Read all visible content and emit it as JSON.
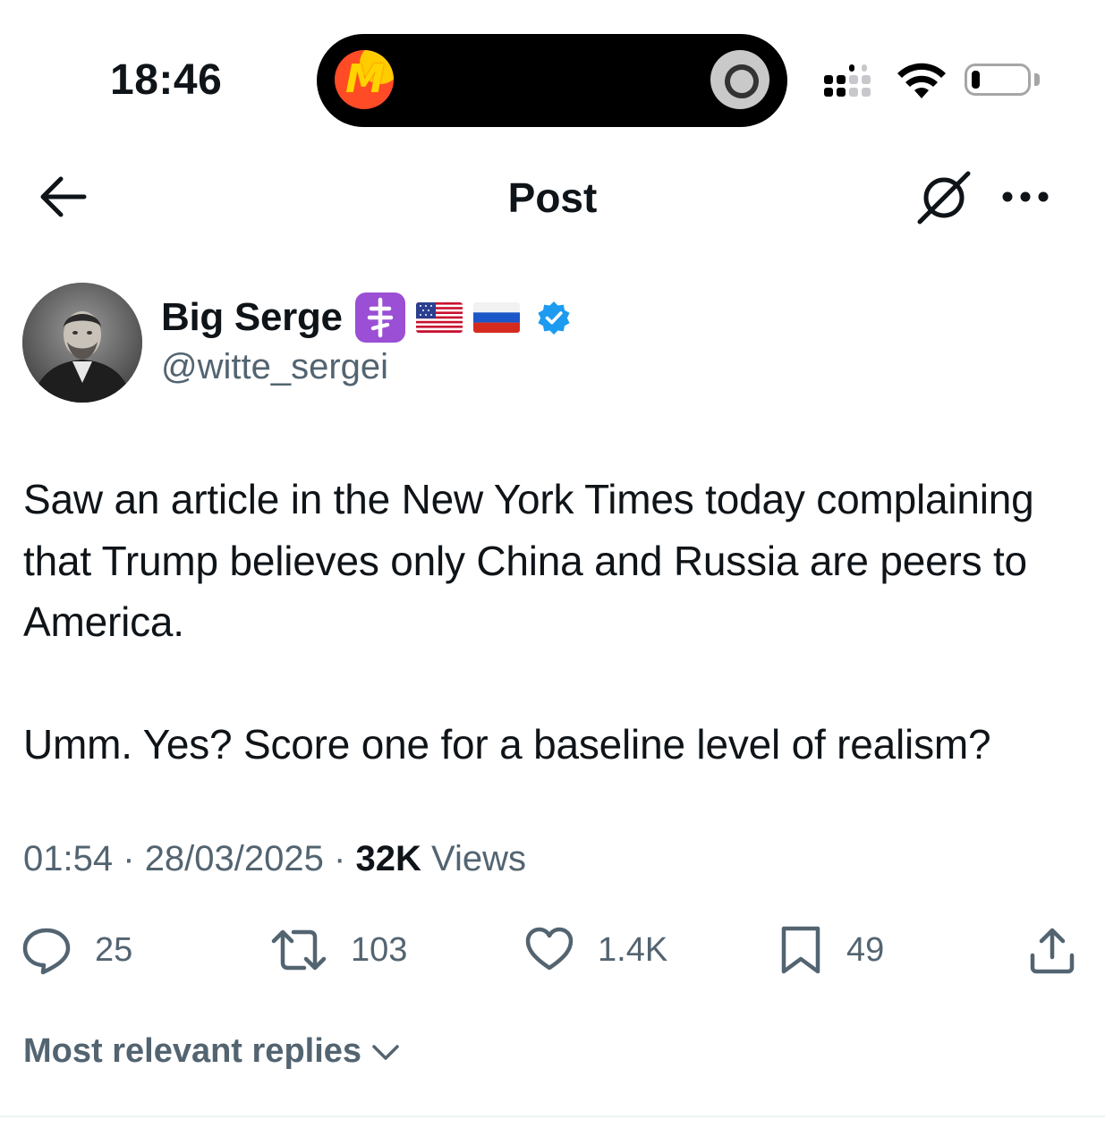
{
  "status_bar": {
    "time": "18:46",
    "battery_level": 0.15
  },
  "header": {
    "title": "Post"
  },
  "author": {
    "display_name": "Big Serge",
    "handle": "@witte_sergei",
    "badges": [
      "orthodox-cross-emoji",
      "us-flag-emoji",
      "russia-flag-emoji"
    ],
    "verified": true
  },
  "post": {
    "text": "Saw an article in the New York Times today complaining that Trump believes only China and Russia are peers to America.\n\nUmm. Yes? Score one for a baseline level of realism?",
    "time": "01:54",
    "separator": "·",
    "date": "28/03/2025",
    "views_count": "32K",
    "views_label": "Views"
  },
  "actions": {
    "replies": "25",
    "reposts": "103",
    "likes": "1.4K",
    "bookmarks": "49"
  },
  "replies_sort": {
    "label": "Most relevant replies"
  },
  "colors": {
    "text_primary": "#0f1419",
    "text_secondary": "#536471",
    "verified_blue": "#1d9bf0",
    "badge_purple": "#9a4fd4"
  }
}
